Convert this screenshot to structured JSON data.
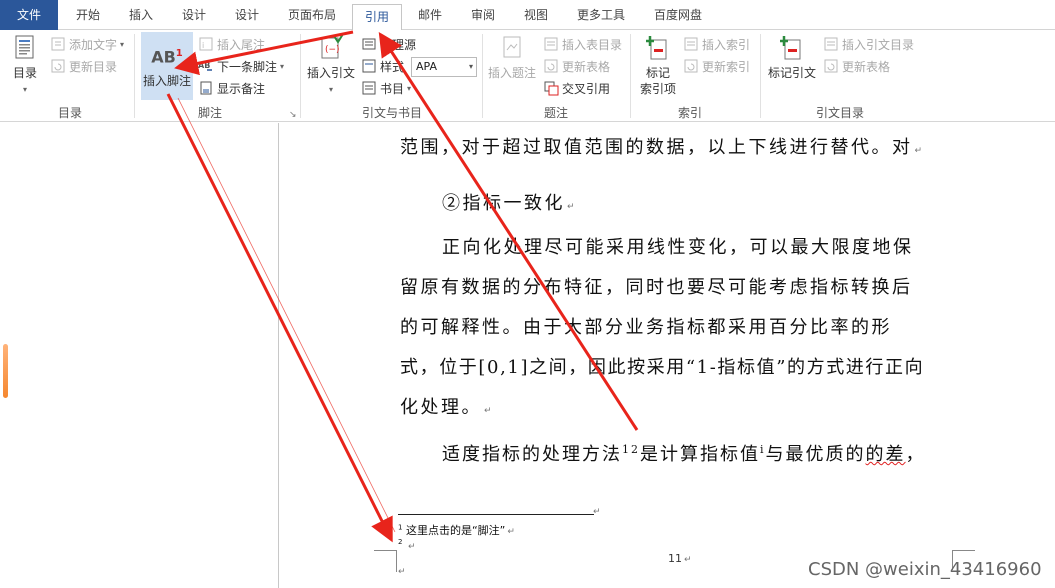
{
  "tabs": [
    "文件",
    "开始",
    "插入",
    "设计",
    "设计",
    "页面布局",
    "引用",
    "邮件",
    "审阅",
    "视图",
    "更多工具",
    "百度网盘"
  ],
  "active_tab_index": 6,
  "ribbon": {
    "toc": {
      "big": "目录",
      "add_text": "添加文字",
      "update_toc": "更新目录",
      "group": "目录"
    },
    "footnote": {
      "insert_footnote_label": "AB",
      "insert_footnote_sup": "1",
      "insert_footnote": "插入脚注",
      "insert_endnote": "插入尾注",
      "next_footnote": "下一条脚注",
      "show_notes": "显示备注",
      "group": "脚注"
    },
    "citation": {
      "insert_citation": "插入引文",
      "manage_sources": "管理源",
      "style": "样式",
      "style_value": "APA",
      "bibliography": "书目",
      "group": "引文与书目"
    },
    "caption": {
      "insert_caption": "插入题注",
      "insert_table_of_figures": "插入表目录",
      "update_table": "更新表格",
      "cross_reference": "交叉引用",
      "group": "题注"
    },
    "index": {
      "mark_entry_l1": "标记",
      "mark_entry_l2": "索引项",
      "insert_index": "插入索引",
      "update_index": "更新索引",
      "group": "索引"
    },
    "toa": {
      "mark_citation": "标记引文",
      "insert_toa": "插入引文目录",
      "update_table": "更新表格",
      "group": "引文目录"
    }
  },
  "document": {
    "lines": [
      "范围，对于超过取值范围的数据，以上下线进行替代。对",
      "②指标一致化",
      "正向化处理尽可能采用线性变化，可以最大限度地保",
      "留原有数据的分布特征，同时也要尽可能考虑指标转换后",
      "的可解释性。由于大部分业务指标都采用百分比率的形",
      "式，位于[0,1]之间，因此按采用“1-指标值”的方式进行正向",
      "化处理。"
    ],
    "last_line": {
      "part1": "适度指标的处理方法",
      "sup1": "12",
      "part2": "是计算指标值",
      "sup2": "i",
      "part3": "与最优质的",
      "part4": "的差",
      "part5": "，"
    },
    "paragraph_mark": "↵",
    "footnotes": [
      {
        "num": "1",
        "text": "这里点击的是“脚注”"
      },
      {
        "num": "2",
        "text": ""
      }
    ],
    "page_number": "11"
  },
  "watermark": "CSDN @weixin_43416960",
  "colors": {
    "file_tab": "#2b579a",
    "active_tab_text": "#2b579a",
    "annotation_arrow": "#e8241b",
    "button_highlight": "#cfe0f3"
  }
}
